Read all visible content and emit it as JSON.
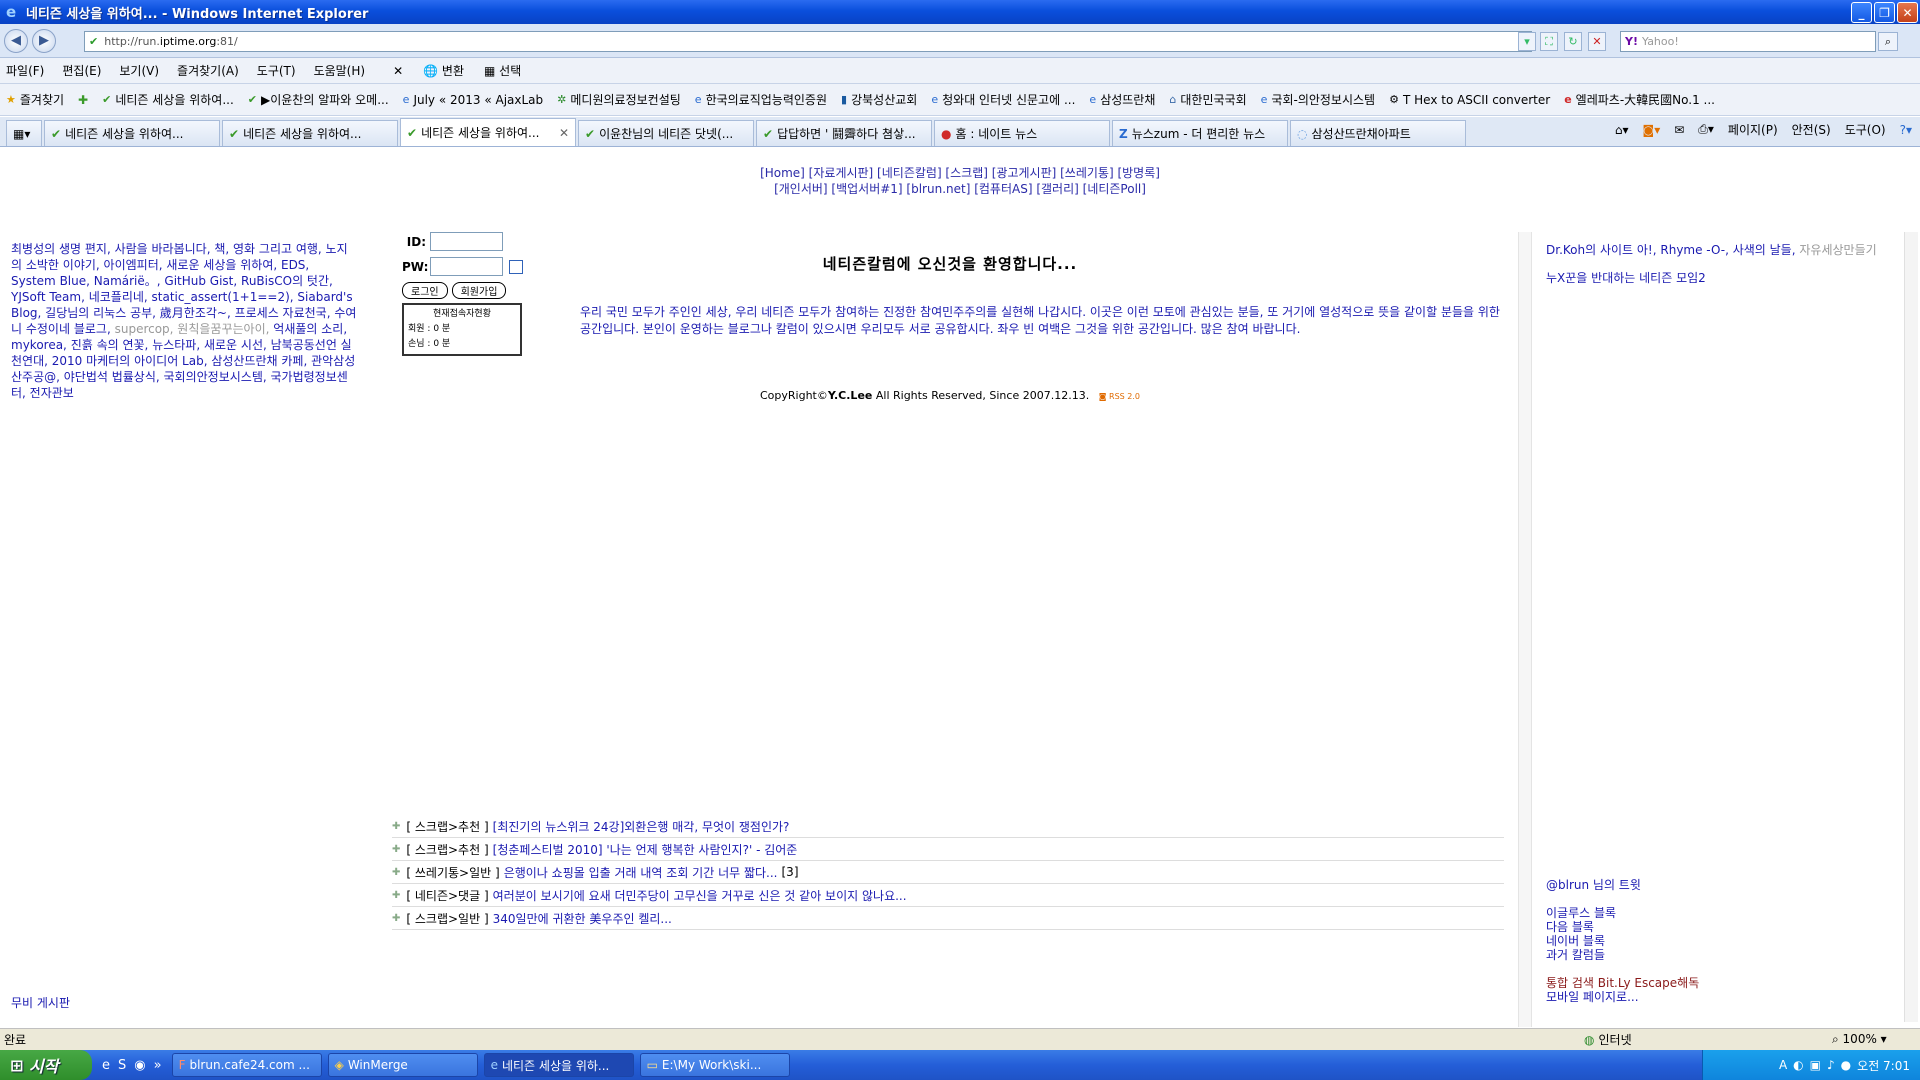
{
  "window": {
    "title": "네티즌 세상을 위하여... - Windows Internet Explorer",
    "controls": [
      "minimize",
      "restore",
      "close"
    ]
  },
  "address": {
    "url_prefix": "http://run.",
    "url_host": "iptime.org",
    "url_suffix": ":81/",
    "search_placeholder": "Yahoo!"
  },
  "menu": {
    "items": [
      "파일(F)",
      "편집(E)",
      "보기(V)",
      "즐겨찾기(A)",
      "도구(T)",
      "도움말(H)"
    ],
    "convert": "변환",
    "select": "선택"
  },
  "favorites": {
    "label": "즐겨찾기",
    "items": [
      "네티즌 세상을 위하여...",
      "▶이윤찬의 알파와 오메...",
      "July « 2013 « AjaxLab",
      "메디원의료정보컨설팅",
      "한국의료직업능력인증원",
      "강북성산교회",
      "청와대 인터넷 신문고에 ...",
      "삼성뜨란채",
      "대한민국국회",
      "국회-의안정보시스템",
      "T Hex to ASCII converter",
      "엘레파츠-大韓民國No.1 ..."
    ]
  },
  "tabs": [
    {
      "label": "네티즌 세상을 위하여...",
      "active": false
    },
    {
      "label": "네티즌 세상을 위하여...",
      "active": false
    },
    {
      "label": "네티즌 세상을 위하여...",
      "active": true
    },
    {
      "label": "이윤찬님의 네티즌 닷넷(...",
      "active": false
    },
    {
      "label": "답답하면 ' 鬪霽하다 쳠샇...",
      "active": false
    },
    {
      "label": "홈 : 네이트 뉴스",
      "active": false
    },
    {
      "label": "뉴스zum - 더 편리한 뉴스",
      "active": false
    },
    {
      "label": "삼성산뜨란채아파트",
      "active": false
    }
  ],
  "tab_tools": {
    "page": "페이지(P)",
    "safety": "안전(S)",
    "tools": "도구(O)"
  },
  "toplinks": {
    "row1": "[Home] [자료게시판] [네티즌칼럼] [스크랩] [광고게시판] [쓰레기통] [방명록]",
    "row2": "[개인서버] [백업서버#1] [blrun.net] [컴퓨터AS] [갤러리] [네티즌Poll]"
  },
  "left": {
    "links": "최병성의 생명 편지, 사람을 바라봅니다, 책, 영화 그리고 여행, 노지의 소박한 이야기, 아이엠피터, 새로운 세상을 위하여, EDS, System Blue, Namárië。, GitHub Gist, RuBisCO의 텃간, YJSoft Team, 네코플리네, static_assert(1+1==2), Siabard's Blog, 길당님의 리눅스 공부, 歲月한조각~, 프로세스 자료천국, 수여니 수정이네 블로그,",
    "gray": "supercop, 원칙을꿈꾸는아이,",
    "links2": "억새풀의 소리, mykorea, 진흙 속의 연꽃, 뉴스타파, 새로운 시선, 남북공동선언 실천연대, 2010 마케터의 아이디어 Lab, 삼성산뜨란채 카페, 관악삼성산주공@, 야단법석 법률상식, 국회의안정보시스템, 국가법령정보센터, 전자관보",
    "footer": "무비 게시판"
  },
  "login": {
    "id_label": "ID:",
    "pw_label": "PW:",
    "login_btn": "로그인",
    "join_btn": "회원가입",
    "stats_title": "현재접속자현황",
    "member_label": "회원 :",
    "member_count": "0 분",
    "guest_label": "손님 :",
    "guest_count": "0 분"
  },
  "main": {
    "welcome": "네티즌칼럼에 오신것을 환영합니다...",
    "intro": "우리 국민 모두가 주인인 세상, 우리 네티즌 모두가 참여하는 진정한 참여민주주의를 실현해 나갑시다. 이곳은 이런 모토에 관심있는 분들, 또 거기에 열성적으로 뜻을 같이할 분들을 위한 공간입니다. 본인이 운영하는 블로그나 칼럼이 있으시면 우리모두 서로 공유합시다. 좌우 빈 여백은 그것을 위한 공간입니다. 많은 참여 바랍니다.",
    "copyright_prefix": "CopyRight©",
    "copyright_name": "Y.C.Lee",
    "copyright_suffix": " All Rights Reserved, Since 2007.12.13.",
    "rss_label": "RSS 2.0"
  },
  "news": [
    {
      "category": "[ 스크랩>추천 ]",
      "title": "[최진기의 뉴스위크 24강]외환은행 매각, 무엇이 쟁점인가?",
      "count": ""
    },
    {
      "category": "[ 스크랩>추천 ]",
      "title": "[청춘페스티벌 2010] '나는 언제 행복한 사람인지?' - 김어준",
      "count": ""
    },
    {
      "category": "[ 쓰레기통>일반 ]",
      "title": "은행이나 쇼핑몰 입출 거래 내역 조회 기간 너무 짧다...",
      "count": "[3]"
    },
    {
      "category": "[ 네티즌>댓글 ]",
      "title": "여러분이 보시기에 요새 더민주당이 고무신을 거꾸로 신은 것 같아 보이지 않나요...",
      "count": ""
    },
    {
      "category": "[ 스크랩>일반 ]",
      "title": "340일만에 귀환한 美우주인 켈리...",
      "count": ""
    }
  ],
  "right": {
    "links": "Dr.Koh의 사이트 아!, Rhyme -O-, 사색의 날들,",
    "gray": "자유세상만들기",
    "group": "누X꾼을 반대하는 네티즌 모임2",
    "tweet": "@blrun 님의 트윗",
    "blogs": [
      "이글루스 블록",
      "다음 블록",
      "네이버 블록",
      "과거 칼럼들"
    ],
    "search": "통합 검색 Bit.Ly Escape해독",
    "mobile": "모바일 페이지로..."
  },
  "status": {
    "text": "완료",
    "zone": "인터넷",
    "zoom": "100%"
  },
  "taskbar": {
    "start": "시작",
    "tasks": [
      {
        "label": "blrun.cafe24.com ...",
        "active": false
      },
      {
        "label": "WinMerge",
        "active": false
      },
      {
        "label": "네티즌 세상을 위하...",
        "active": true
      },
      {
        "label": "E:\\My Work\\ski...",
        "active": false
      }
    ],
    "clock": "오전 7:01"
  }
}
